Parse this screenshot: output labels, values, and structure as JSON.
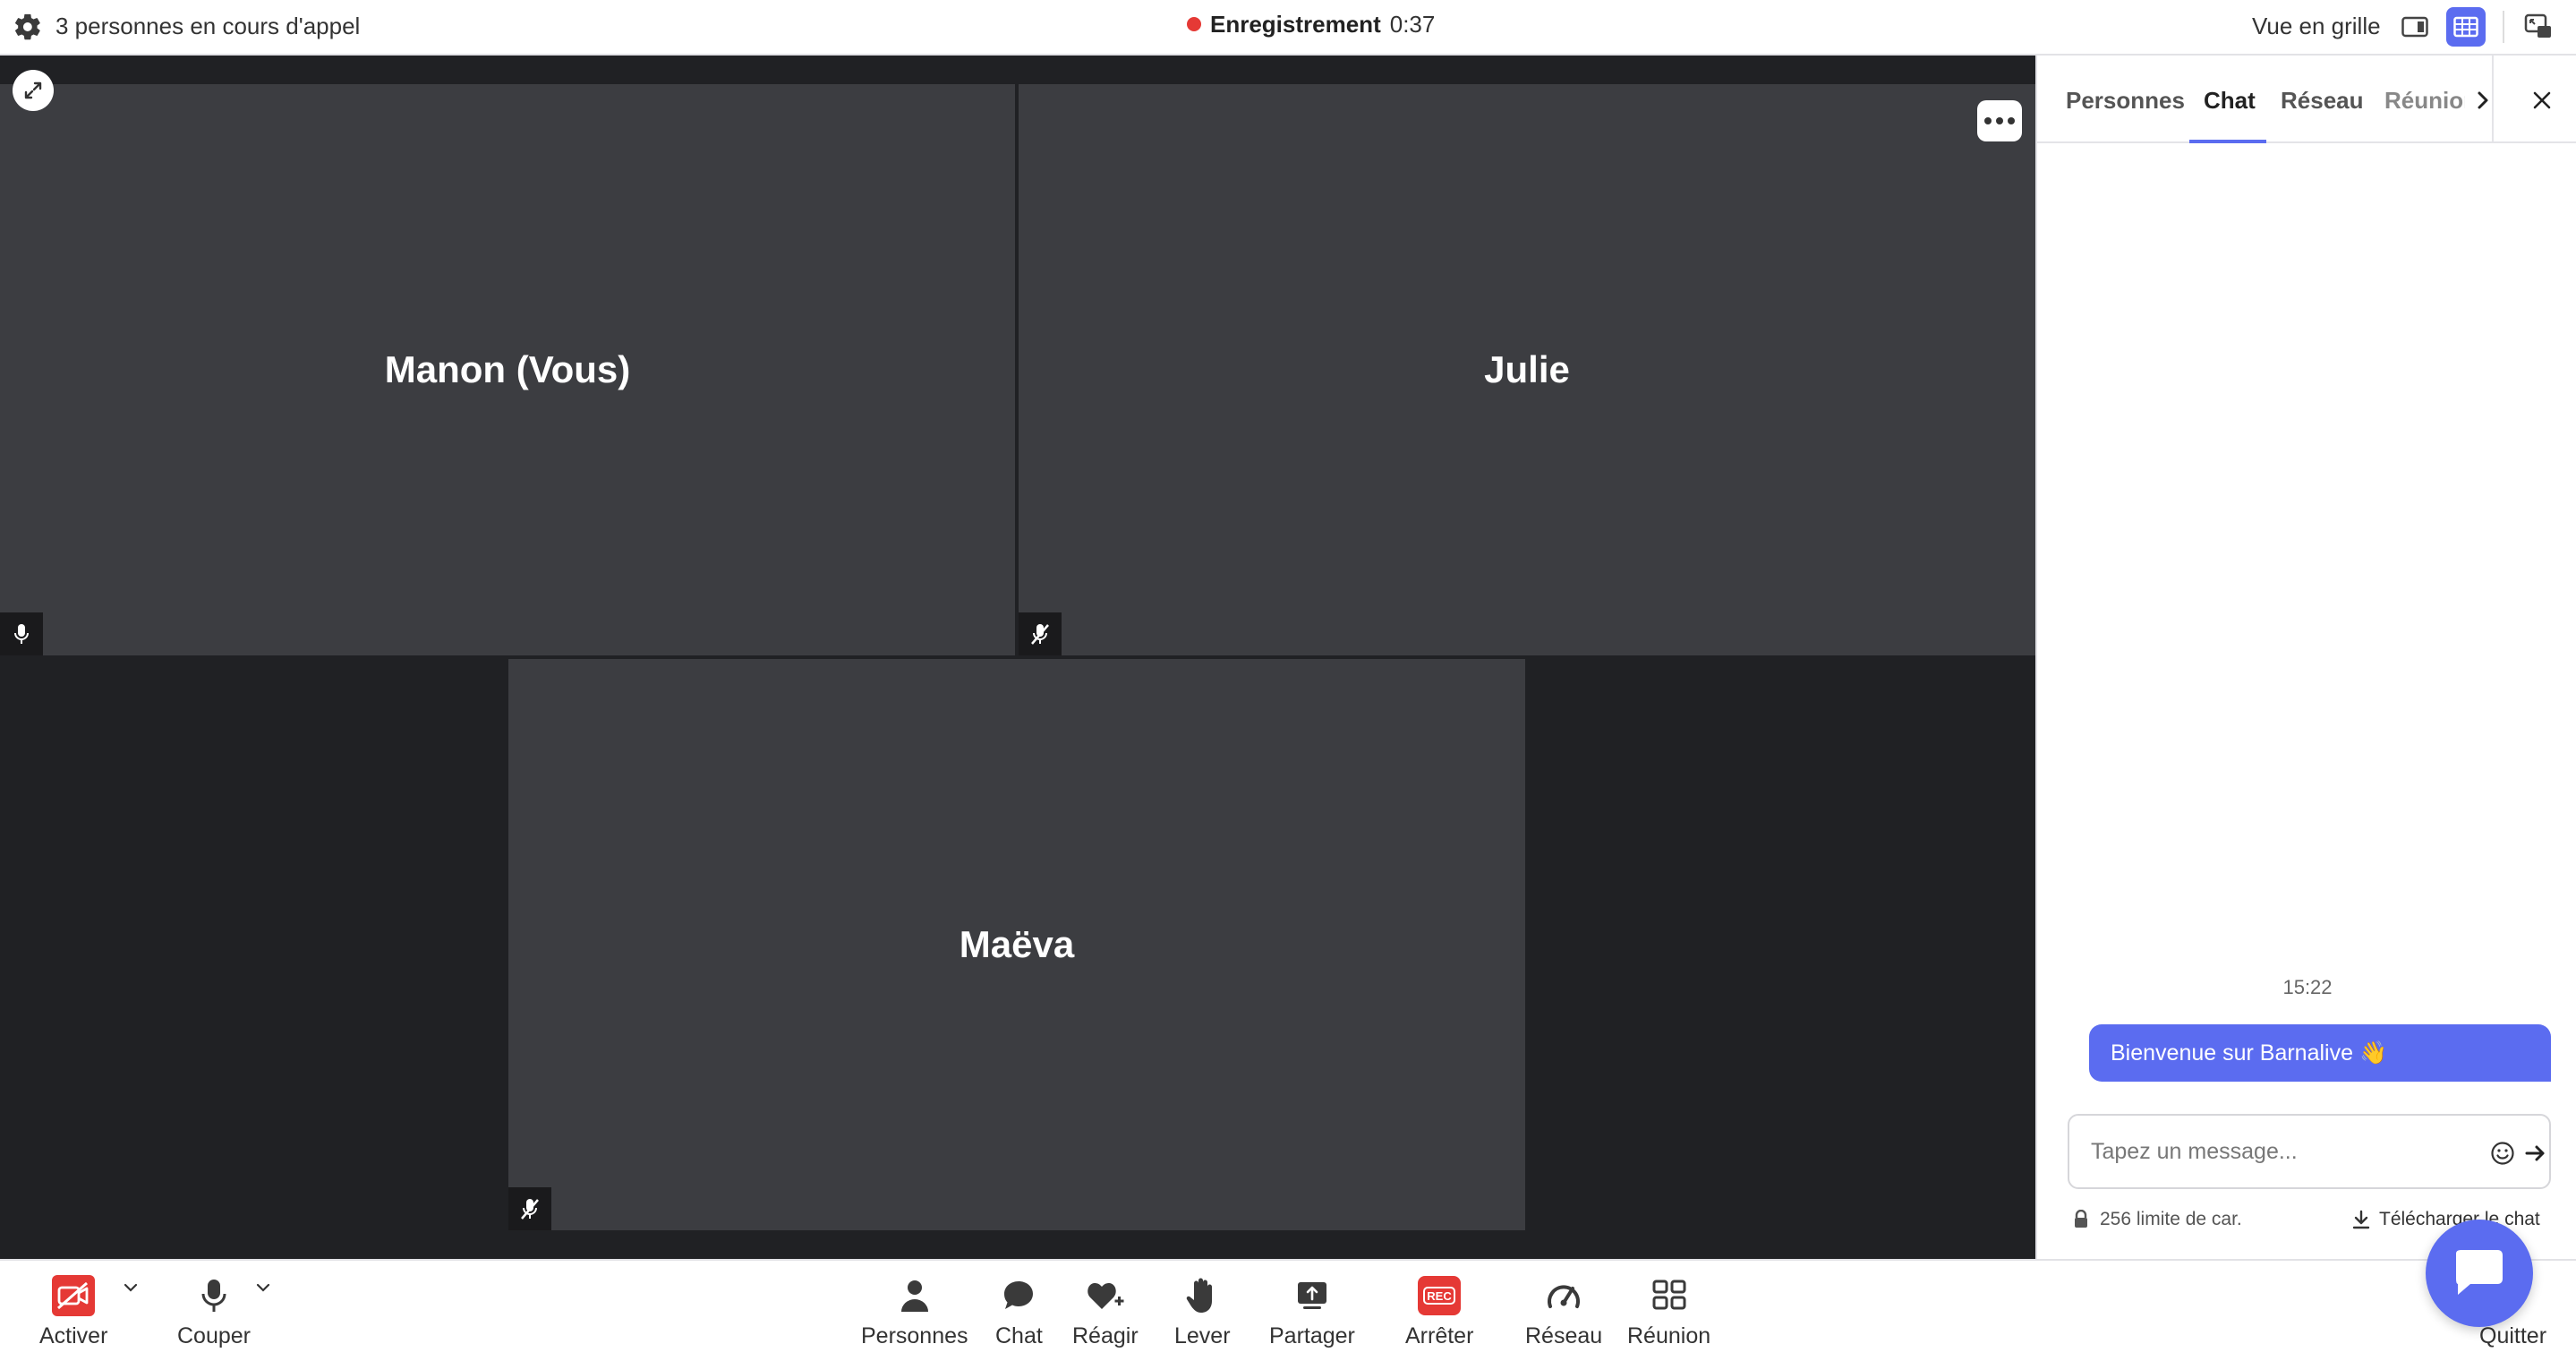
{
  "topbar": {
    "participants_text": "3 personnes en cours d'appel",
    "recording_label": "Enregistrement",
    "recording_time": "0:37",
    "view_label": "Vue en grille"
  },
  "tiles": [
    {
      "name": "Manon (Vous)",
      "mic": "unmuted"
    },
    {
      "name": "Julie",
      "mic": "muted"
    },
    {
      "name": "Maëva",
      "mic": "muted"
    }
  ],
  "panel": {
    "tabs": [
      "Personnes",
      "Chat",
      "Réseau",
      "Réunion"
    ],
    "active_tab": "Chat",
    "messages": [
      {
        "time": "15:22",
        "text": "Bienvenue sur Barnalive 👋"
      }
    ],
    "input_placeholder": "Tapez un message...",
    "char_limit": "256 limite de car.",
    "download_label": "Télécharger le chat"
  },
  "toolbar": {
    "left": [
      {
        "label": "Activer",
        "icon": "camera-off-icon"
      },
      {
        "label": "Couper",
        "icon": "microphone-icon"
      }
    ],
    "center": [
      {
        "label": "Personnes",
        "icon": "person-icon"
      },
      {
        "label": "Chat",
        "icon": "chat-bubble-icon"
      },
      {
        "label": "Réagir",
        "icon": "heart-plus-icon"
      },
      {
        "label": "Lever",
        "icon": "hand-icon"
      },
      {
        "label": "Partager",
        "icon": "screen-share-icon"
      },
      {
        "label": "Arrêter",
        "icon": "rec-icon",
        "badge": "REC"
      },
      {
        "label": "Réseau",
        "icon": "gauge-icon"
      },
      {
        "label": "Réunion",
        "icon": "grid-icon"
      }
    ],
    "right": [
      {
        "label": "Quitter",
        "icon": "leave-icon"
      }
    ]
  },
  "colors": {
    "accent": "#5b6cf0",
    "danger": "#e53935",
    "stage_bg": "#202124",
    "tile_bg": "#3c3d41",
    "rec_dot": "#e53935"
  }
}
